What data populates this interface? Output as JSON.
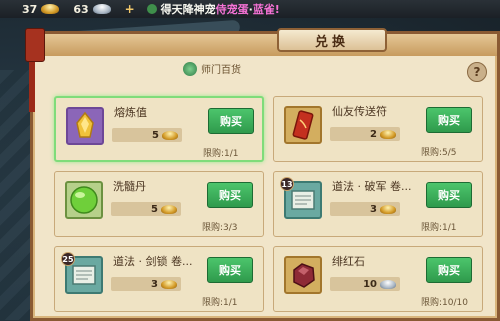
{
  "topbar": {
    "gold_count": "37",
    "silver_count": "63",
    "ticker_white": "得天降神宠",
    "ticker_pink": "侍宠蛋",
    "ticker_sep": "·",
    "ticker_tail": "蓝雀!",
    "icons": {
      "gold": "gold-ingot-icon",
      "silver": "silver-ingot-icon",
      "add": "plus-icon"
    }
  },
  "panel": {
    "title": "兑换",
    "shop_tab_label": "师门百货",
    "help_label": "?"
  },
  "items": [
    {
      "name": "熔炼值",
      "price": "5",
      "currency": "gold",
      "limit": "限购:1/1",
      "buy_label": "购买",
      "icon": "gold-crystal-icon",
      "badge": "",
      "selected": true
    },
    {
      "name": "仙友传送符",
      "price": "2",
      "currency": "gold",
      "limit": "限购:5/5",
      "buy_label": "购买",
      "icon": "teleport-talisman-icon",
      "badge": "",
      "selected": false
    },
    {
      "name": "洗髓丹",
      "price": "5",
      "currency": "gold",
      "limit": "限购:3/3",
      "buy_label": "购买",
      "icon": "green-pill-icon",
      "badge": "",
      "selected": false
    },
    {
      "name": "道法 · 破军 卷...",
      "price": "3",
      "currency": "gold",
      "limit": "限购:1/1",
      "buy_label": "购买",
      "icon": "scroll-icon",
      "badge": "13",
      "selected": false
    },
    {
      "name": "道法 · 剑锁 卷...",
      "price": "3",
      "currency": "gold",
      "limit": "限购:1/1",
      "buy_label": "购买",
      "icon": "scroll-icon",
      "badge": "25",
      "selected": false
    },
    {
      "name": "绯红石",
      "price": "10",
      "currency": "silver",
      "limit": "限购:10/10",
      "buy_label": "购买",
      "icon": "crimson-stone-icon",
      "badge": "",
      "selected": false
    }
  ],
  "colors": {
    "panel_bg": "#f1e5c9",
    "buy_button": "#3fb45f",
    "selected_border": "#7fdc7a",
    "ticker_pink": "#f572d5"
  }
}
